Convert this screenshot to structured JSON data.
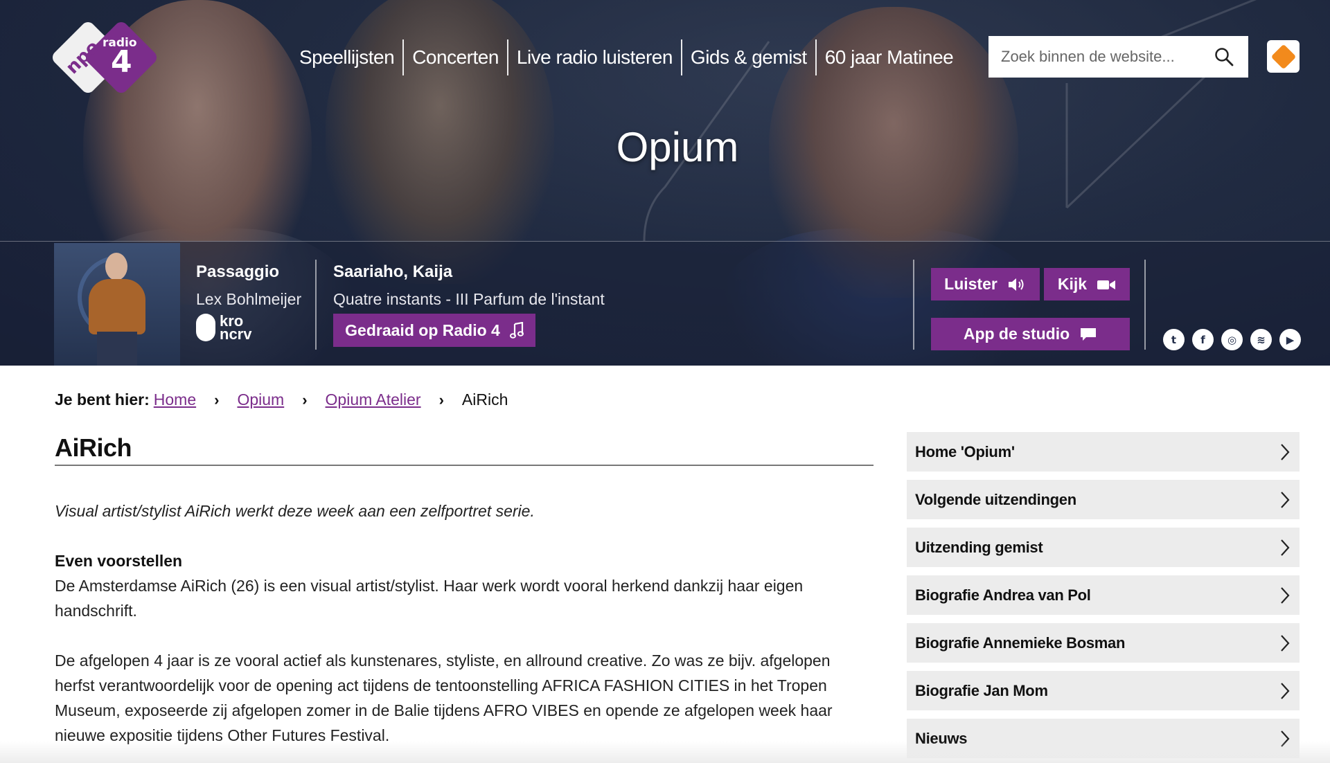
{
  "logo": {
    "npo": "npo",
    "radio": "radio",
    "number": "4"
  },
  "nav": [
    "Speellijsten",
    "Concerten",
    "Live radio luisteren",
    "Gids & gemist",
    "60 jaar Matinee"
  ],
  "search": {
    "placeholder": "Zoek binnen de website..."
  },
  "show_title": "Opium",
  "player": {
    "program": "Passaggio",
    "host": "Lex Bohlmeijer",
    "broadcaster": [
      "kro",
      "ncrv"
    ],
    "composer": "Saariaho, Kaija",
    "work": "Quatre instants - III Parfum de l'instant",
    "played_button": "Gedraaid op Radio 4",
    "listen_button": "Luister",
    "watch_button": "Kijk",
    "app_button": "App de studio"
  },
  "social": [
    "twitter-icon",
    "facebook-icon",
    "instagram-icon",
    "spotify-icon",
    "youtube-icon"
  ],
  "breadcrumb": {
    "label": "Je bent hier:",
    "items": [
      "Home",
      "Opium",
      "Opium Atelier"
    ],
    "current": "AiRich"
  },
  "article": {
    "title": "AiRich",
    "intro": "Visual artist/stylist AiRich werkt deze week aan een zelfportret serie.",
    "subhead": "Even voorstellen",
    "para1": "De Amsterdamse AiRich (26) is een visual artist/stylist. Haar werk wordt vooral herkend dankzij haar eigen handschrift.",
    "para2": "De afgelopen 4 jaar is ze vooral actief als kunstenares, styliste, en allround creative. Zo was ze bijv. afgelopen herfst verantwoordelijk voor de opening act tijdens de tentoonstelling AFRICA FASHION CITIES in het Tropen Museum, exposeerde zij afgelopen zomer in de Balie tijdens AFRO VIBES en opende ze afgelopen week haar nieuwe expositie tijdens Other Futures Festival."
  },
  "sidenav": [
    "Home 'Opium'",
    "Volgende uitzendingen",
    "Uitzending gemist",
    "Biografie Andrea van Pol",
    "Biografie Annemieke Bosman",
    "Biografie Jan Mom",
    "Nieuws"
  ],
  "colors": {
    "accent": "#7b2d8b",
    "npo_orange": "#f28a1c",
    "hero_dark": "#1c2540"
  }
}
